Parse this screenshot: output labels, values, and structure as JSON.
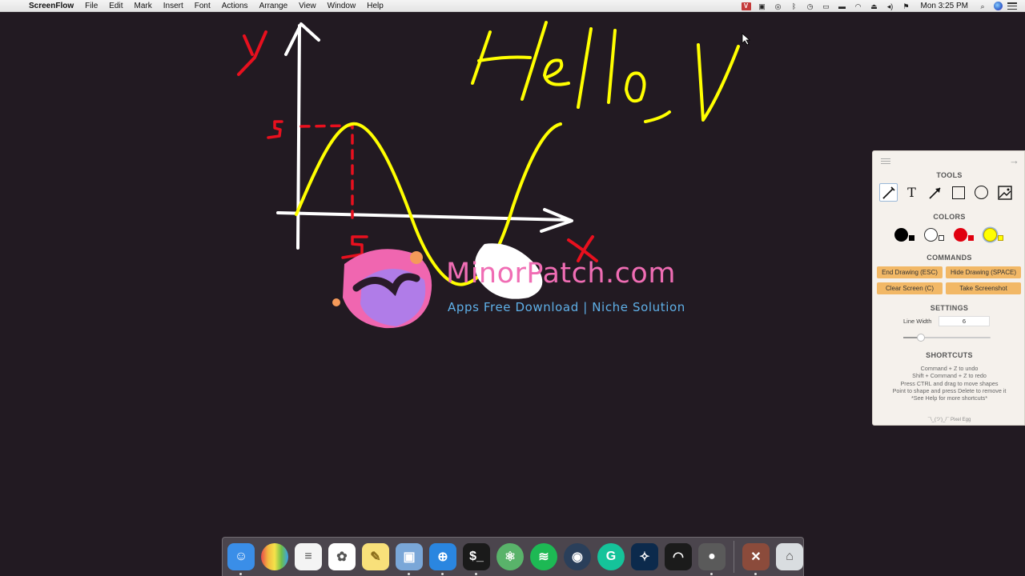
{
  "menubar": {
    "app_name": "ScreenFlow",
    "menus": [
      "File",
      "Edit",
      "Mark",
      "Insert",
      "Font",
      "Actions",
      "Arrange",
      "View",
      "Window",
      "Help"
    ],
    "clock": "Mon 3:25 PM",
    "status_icons": [
      "vivaldi-icon",
      "screenflow-icon",
      "record-icon",
      "bluetooth-icon",
      "time-machine-icon",
      "airplay-icon",
      "battery-icon",
      "wifi-icon",
      "volume-icon",
      "flag-icon",
      "search-icon",
      "siri-icon",
      "notification-list-icon"
    ]
  },
  "watermark": {
    "title": "MinorPatch.com",
    "subtitle": "Apps Free Download | Niche Solution"
  },
  "panel": {
    "tools_title": "TOOLS",
    "tools": [
      "pencil",
      "text",
      "arrow",
      "rectangle",
      "ellipse",
      "image"
    ],
    "colors_title": "COLORS",
    "colors": [
      {
        "name": "black",
        "hex": "#000000"
      },
      {
        "name": "white",
        "hex": "#ffffff"
      },
      {
        "name": "red",
        "hex": "#e0000f"
      },
      {
        "name": "yellow",
        "hex": "#ffff00"
      }
    ],
    "active_color": "yellow",
    "commands_title": "COMMANDS",
    "commands": {
      "end_drawing": "End Drawing (ESC)",
      "hide_drawing": "Hide Drawing (SPACE)",
      "clear_screen": "Clear Screen (C)",
      "take_screenshot": "Take Screenshot"
    },
    "settings_title": "SETTINGS",
    "line_width_label": "Line Width",
    "line_width_value": "6",
    "line_width_slider": 0.2,
    "shortcuts_title": "SHORTCUTS",
    "shortcuts": [
      "Command + Z to undo",
      "Shift + Command + Z to redo",
      "Press CTRL and drag to move shapes",
      "Point to shape and press Delete to remove it",
      "*See Help for more shortcuts*"
    ],
    "credit": "¯\\_(ツ)_/¯ Pixel Egg"
  },
  "dock": {
    "apps": [
      {
        "name": "finder",
        "color": "#3a8ee8",
        "glyph": "☺",
        "running": true
      },
      {
        "name": "colorsync",
        "color": "#6fbf4a",
        "glyph": "",
        "running": false
      },
      {
        "name": "reminders",
        "color": "#f4f4f4",
        "glyph": "≡",
        "running": false
      },
      {
        "name": "photos",
        "color": "#ffffff",
        "glyph": "✿",
        "running": false
      },
      {
        "name": "notes",
        "color": "#f8e07a",
        "glyph": "✎",
        "running": false
      },
      {
        "name": "preview",
        "color": "#7aa7d8",
        "glyph": "▣",
        "running": true
      },
      {
        "name": "safari",
        "color": "#2a86e0",
        "glyph": "⊕",
        "running": true
      },
      {
        "name": "terminal",
        "color": "#1a1a1a",
        "glyph": "$_",
        "running": true
      },
      {
        "name": "atom",
        "color": "#59b36a",
        "glyph": "⚛",
        "running": false
      },
      {
        "name": "spotify",
        "color": "#1db954",
        "glyph": "≋",
        "running": false
      },
      {
        "name": "steam",
        "color": "#2a3f5a",
        "glyph": "◉",
        "running": false
      },
      {
        "name": "grammarly",
        "color": "#15c39a",
        "glyph": "G",
        "running": false
      },
      {
        "name": "xcode",
        "color": "#0c2a4c",
        "glyph": "✧",
        "running": false
      },
      {
        "name": "instruments",
        "color": "#1b1b1b",
        "glyph": "◠",
        "running": false
      },
      {
        "name": "photo-booth",
        "color": "#5a5a5a",
        "glyph": "●",
        "running": true
      },
      {
        "name": "screenflow",
        "color": "#8b4b3b",
        "glyph": "✕",
        "running": true
      },
      {
        "name": "trash",
        "color": "#d9dde0",
        "glyph": "⌂",
        "running": false
      }
    ]
  }
}
